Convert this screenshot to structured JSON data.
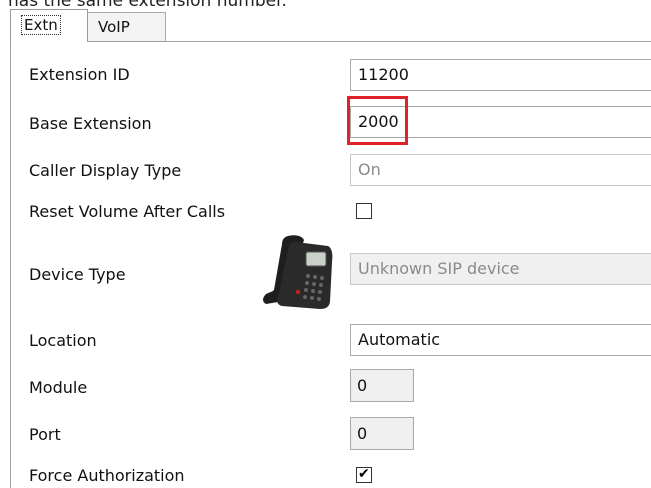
{
  "window": {
    "top_text": "has the same extension number."
  },
  "tabs": [
    {
      "label": "Extn"
    },
    {
      "label": "VoIP"
    }
  ],
  "form": {
    "extension_id": {
      "label": "Extension ID",
      "value": "11200"
    },
    "base_extension": {
      "label": "Base Extension",
      "value": "2000"
    },
    "caller_display_type": {
      "label": "Caller Display Type",
      "value": "On"
    },
    "reset_volume": {
      "label": "Reset Volume After Calls",
      "checked": false
    },
    "device_type": {
      "label": "Device Type",
      "value": "Unknown SIP device",
      "icon": "desk-phone-icon"
    },
    "location": {
      "label": "Location",
      "value": "Automatic"
    },
    "module": {
      "label": "Module",
      "value": "0"
    },
    "port": {
      "label": "Port",
      "value": "0"
    },
    "force_authorization": {
      "label": "Force Authorization",
      "checked": true
    }
  },
  "colors": {
    "highlight": "#e0222a",
    "border": "#a9a9a9",
    "disabled_bg": "#f0f0f0"
  }
}
